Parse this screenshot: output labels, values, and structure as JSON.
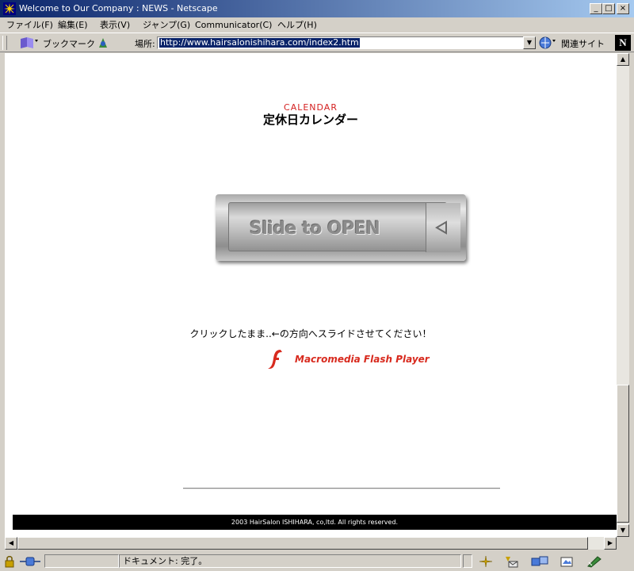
{
  "window": {
    "title": "Welcome to Our Company : NEWS - Netscape"
  },
  "menu": [
    "ファイル(F)",
    "編集(E)",
    "表示(V)",
    "ジャンプ(G)",
    "Communicator(C)",
    "ヘルプ(H)"
  ],
  "toolbar": {
    "bookmarks": "ブックマーク",
    "location_label": "場所:",
    "url": "http://www.hairsalonishihara.com/index2.htm",
    "related": "関連サイト"
  },
  "page": {
    "calendar_en": "CALENDAR",
    "calendar_jp": "定休日カレンダー",
    "flash_label": "Slide to OPEN",
    "instruction": "クリックしたまま..←の方向へスライドさせてください！",
    "flash_player": "Macromedia Flash Player",
    "copyright": "2003 HairSalon ISHIHARA, co,ltd. All rights reserved."
  },
  "status": {
    "text": "ドキュメント: 完了。"
  },
  "colors": {
    "accent_red": "#d42020",
    "titlebar": "#0a246a",
    "footer_bg": "#000000"
  }
}
